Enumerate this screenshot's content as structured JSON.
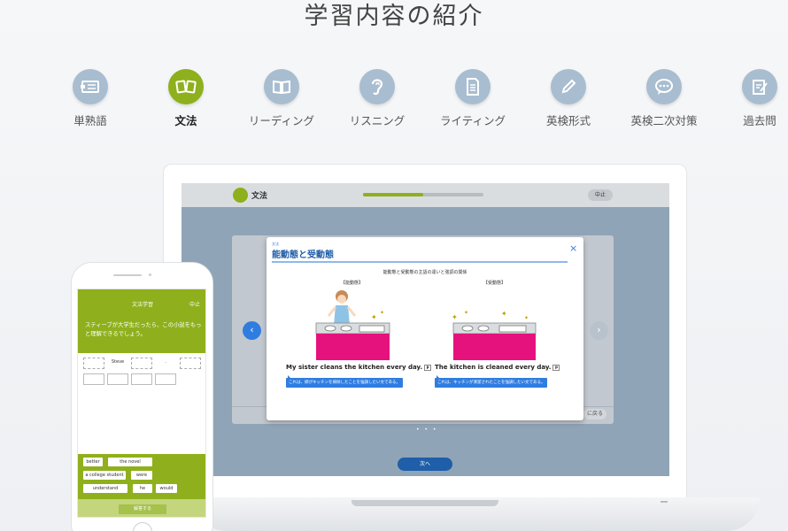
{
  "page": {
    "title": "学習内容の紹介"
  },
  "nav": [
    {
      "label": "単熟語",
      "icon": "vocab-card-icon"
    },
    {
      "label": "文法",
      "icon": "grammar-icon",
      "active": true
    },
    {
      "label": "リーディング",
      "icon": "book-icon"
    },
    {
      "label": "リスニング",
      "icon": "ear-icon"
    },
    {
      "label": "ライティング",
      "icon": "document-icon"
    },
    {
      "label": "英検形式",
      "icon": "pencil-icon"
    },
    {
      "label": "英検二次対策",
      "icon": "speech-bubble-icon"
    },
    {
      "label": "過去問",
      "icon": "edit-note-icon"
    }
  ],
  "laptop": {
    "header_title": "文法",
    "progress": 0.5,
    "quit_label": "中止",
    "back_label": "に戻る",
    "next_label": "次へ",
    "dots": "• • •",
    "modal": {
      "kicker": "文法",
      "title": "能動態と受動態",
      "close": "×",
      "subtitle": "能動態と受動態の主語の違いと強調の関係",
      "left": {
        "label": "【能動態】",
        "sentence": "My sister cleans the kitchen every day.",
        "note": "これは、姉がキッチンを掃除したことを強調したい文である。"
      },
      "right": {
        "label": "【受動態】",
        "sentence": "The kitchen is cleaned every day.",
        "note": "これは、キッチンが清潔されたことを強調したい文である。"
      },
      "speaker": "P"
    }
  },
  "phone": {
    "title": "文法学習",
    "quit_label": "中止",
    "question": "スティーブが大学生だったら、この小説をもっと理解できるでしょう。",
    "slot_steve": "Steve",
    "slot_period": ".",
    "chips": [
      "better",
      "the novel",
      "a college student",
      "were",
      "understand",
      "he",
      "would"
    ],
    "submit_label": "解答する"
  },
  "colors": {
    "accent_green": "#8db01c",
    "accent_blue": "#2f7de0",
    "magenta": "#e5127d"
  }
}
